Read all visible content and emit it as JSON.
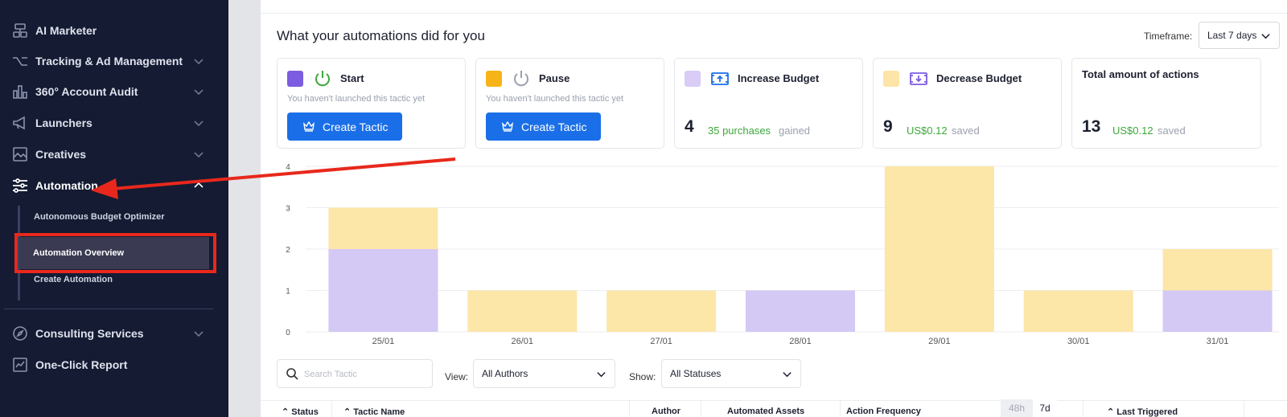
{
  "sidebar": {
    "items": [
      {
        "label": "AI Marketer",
        "icon": "ai-marketer-icon"
      },
      {
        "label": "Tracking & Ad Management",
        "icon": "tracking-icon"
      },
      {
        "label": "360° Account Audit",
        "icon": "audit-chart-icon"
      },
      {
        "label": "Launchers",
        "icon": "megaphone-icon"
      },
      {
        "label": "Creatives",
        "icon": "image-icon"
      },
      {
        "label": "Automation",
        "icon": "sliders-icon"
      },
      {
        "label": "Consulting Services",
        "icon": "compass-icon"
      },
      {
        "label": "One-Click Report",
        "icon": "report-chart-icon"
      }
    ],
    "sub_items": [
      {
        "label": "Autonomous Budget Optimizer"
      },
      {
        "label": "Automation Overview"
      },
      {
        "label": "Create Automation"
      }
    ]
  },
  "main": {
    "title": "What your automations did for you",
    "timeframe_label": "Timeframe:",
    "timeframe_value": "Last 7 days",
    "cards": [
      {
        "title": "Start",
        "color": "#7c5ce0",
        "hint": "You haven't launched this tactic yet",
        "button": "Create Tactic"
      },
      {
        "title": "Pause",
        "color": "#f6b418",
        "hint": "You haven't launched this tactic yet",
        "button": "Create Tactic"
      },
      {
        "title": "Increase Budget",
        "color": "#d9ccf6",
        "value": "4",
        "metric": "35 purchases",
        "suffix": "gained"
      },
      {
        "title": "Decrease Budget",
        "color": "#fce5a6",
        "value": "9",
        "metric": "US$0.12",
        "suffix": "saved"
      },
      {
        "title": "Total amount of actions",
        "value": "13",
        "metric": "US$0.12",
        "suffix": "saved"
      }
    ]
  },
  "chart_data": {
    "type": "bar",
    "stacked": true,
    "categories": [
      "25/01",
      "26/01",
      "27/01",
      "28/01",
      "29/01",
      "30/01",
      "31/01"
    ],
    "series": [
      {
        "color": "#d4c8f4",
        "values": [
          2,
          0,
          0,
          1,
          0,
          0,
          1
        ]
      },
      {
        "color": "#fce6a8",
        "values": [
          1,
          1,
          1,
          0,
          4,
          1,
          1
        ]
      }
    ],
    "y_ticks": [
      "0",
      "1",
      "2",
      "3",
      "4"
    ],
    "ylim": [
      0,
      4
    ],
    "grid": true
  },
  "filters": {
    "search_placeholder": "Search Tactic",
    "view_label": "View:",
    "view_value": "All Authors",
    "show_label": "Show:",
    "show_value": "All Statuses"
  },
  "table": {
    "columns": [
      "Status",
      "Tactic Name",
      "Author",
      "Automated Assets",
      "Action Frequency",
      "Last Triggered"
    ],
    "frequency_options": [
      "48h",
      "7d"
    ]
  }
}
